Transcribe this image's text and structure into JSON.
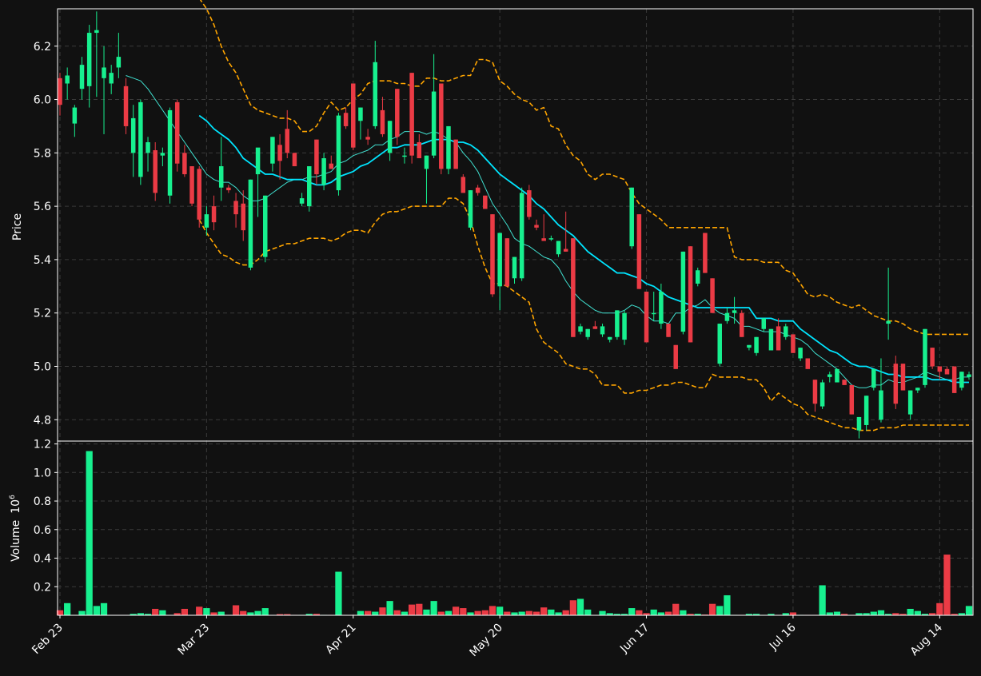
{
  "chart_data": {
    "type": "candlestick",
    "background": "#111111",
    "colors": {
      "up": "#17f08f",
      "down": "#eb3b45",
      "ma_short": "#40e0d0",
      "ma_long": "#00e5ff",
      "bands": "#ffa500",
      "grid": "#3a3a3a",
      "axis": "#ffffff"
    },
    "grid": true,
    "price_panel": {
      "ylabel": "Price",
      "ylim": [
        4.72,
        6.34
      ],
      "yticks": [
        "4.8",
        "5.0",
        "5.2",
        "5.4",
        "5.6",
        "5.8",
        "6.0",
        "6.2"
      ]
    },
    "volume_panel": {
      "ylabel": "Volume",
      "exponent": "10",
      "exponent_power": "6",
      "ylim": [
        0,
        1.22
      ],
      "yticks": [
        "0.2",
        "0.4",
        "0.6",
        "0.8",
        "1.0",
        "1.2"
      ]
    },
    "x_ticks": [
      {
        "label": "Feb 23",
        "i": 0
      },
      {
        "label": "Mar 23",
        "i": 20
      },
      {
        "label": "Apr 21",
        "i": 40
      },
      {
        "label": "May 20",
        "i": 60
      },
      {
        "label": "Jun 17",
        "i": 80
      },
      {
        "label": "Jul 16",
        "i": 100
      },
      {
        "label": "Aug 14",
        "i": 120
      }
    ],
    "n_bars": 125,
    "candles": [
      [
        6.08,
        6.1,
        5.94,
        5.98
      ],
      [
        6.06,
        6.12,
        6.0,
        6.09
      ],
      [
        5.91,
        5.98,
        5.86,
        5.97
      ],
      [
        6.04,
        6.16,
        6.0,
        6.13
      ],
      [
        6.05,
        6.28,
        5.97,
        6.25
      ],
      [
        6.25,
        6.33,
        6.01,
        6.26
      ],
      [
        6.08,
        6.2,
        5.87,
        6.12
      ],
      [
        6.06,
        6.13,
        6.02,
        6.1
      ],
      [
        6.12,
        6.25,
        6.08,
        6.16
      ],
      [
        6.05,
        6.08,
        5.87,
        5.9
      ],
      [
        5.8,
        5.98,
        5.71,
        5.93
      ],
      [
        5.71,
        6.0,
        5.68,
        5.99
      ],
      [
        5.8,
        5.86,
        5.73,
        5.84
      ],
      [
        5.81,
        5.84,
        5.62,
        5.65
      ],
      [
        5.79,
        5.82,
        5.75,
        5.8
      ],
      [
        5.64,
        5.97,
        5.61,
        5.96
      ],
      [
        5.99,
        6.0,
        5.73,
        5.76
      ],
      [
        5.8,
        5.83,
        5.71,
        5.72
      ],
      [
        5.75,
        5.75,
        5.6,
        5.61
      ],
      [
        5.74,
        5.75,
        5.52,
        5.55
      ],
      [
        5.52,
        5.6,
        5.49,
        5.57
      ],
      [
        5.6,
        5.64,
        5.51,
        5.54
      ],
      [
        5.67,
        5.86,
        5.62,
        5.75
      ],
      [
        5.67,
        5.68,
        5.65,
        5.66
      ],
      [
        5.62,
        5.65,
        5.52,
        5.57
      ],
      [
        5.61,
        5.66,
        5.47,
        5.51
      ],
      [
        5.37,
        5.7,
        5.36,
        5.7
      ],
      [
        5.72,
        5.77,
        5.56,
        5.82
      ],
      [
        5.41,
        5.64,
        5.39,
        5.64
      ],
      [
        5.76,
        5.86,
        5.73,
        5.86
      ],
      [
        5.83,
        5.87,
        5.7,
        5.77
      ],
      [
        5.89,
        5.96,
        5.78,
        5.8
      ],
      [
        5.8,
        5.8,
        5.75,
        5.75
      ],
      [
        5.61,
        5.65,
        5.6,
        5.63
      ],
      [
        5.6,
        5.75,
        5.58,
        5.75
      ],
      [
        5.85,
        5.85,
        5.68,
        5.72
      ],
      [
        5.68,
        5.8,
        5.66,
        5.78
      ],
      [
        5.76,
        5.79,
        5.75,
        5.74
      ],
      [
        5.66,
        5.95,
        5.64,
        5.94
      ],
      [
        5.95,
        5.97,
        5.89,
        5.9
      ],
      [
        6.06,
        6.06,
        5.81,
        5.82
      ],
      [
        5.92,
        5.97,
        5.85,
        5.97
      ],
      [
        5.86,
        5.89,
        5.83,
        5.85
      ],
      [
        5.9,
        6.22,
        5.89,
        6.14
      ],
      [
        5.96,
        6.01,
        5.86,
        5.87
      ],
      [
        5.8,
        5.92,
        5.77,
        5.92
      ],
      [
        6.04,
        6.04,
        5.83,
        5.86
      ],
      [
        5.79,
        5.82,
        5.76,
        5.79
      ],
      [
        6.1,
        6.1,
        5.76,
        5.79
      ],
      [
        5.84,
        5.87,
        5.78,
        5.78
      ],
      [
        5.74,
        5.79,
        5.61,
        5.79
      ],
      [
        5.79,
        6.17,
        5.78,
        6.03
      ],
      [
        6.06,
        6.06,
        5.72,
        5.74
      ],
      [
        5.74,
        5.9,
        5.72,
        5.9
      ],
      [
        5.85,
        5.85,
        5.74,
        5.74
      ],
      [
        5.71,
        5.72,
        5.65,
        5.65
      ],
      [
        5.52,
        5.66,
        5.51,
        5.66
      ],
      [
        5.67,
        5.68,
        5.64,
        5.65
      ],
      [
        5.64,
        5.64,
        5.59,
        5.59
      ],
      [
        5.57,
        5.57,
        5.26,
        5.27
      ],
      [
        5.3,
        5.5,
        5.21,
        5.5
      ],
      [
        5.48,
        5.48,
        5.3,
        5.3
      ],
      [
        5.33,
        5.41,
        5.31,
        5.41
      ],
      [
        5.33,
        5.67,
        5.32,
        5.65
      ],
      [
        5.66,
        5.68,
        5.55,
        5.56
      ],
      [
        5.53,
        5.55,
        5.51,
        5.52
      ],
      [
        5.48,
        5.57,
        5.47,
        5.47
      ],
      [
        5.48,
        5.49,
        5.47,
        5.48
      ],
      [
        5.42,
        5.47,
        5.41,
        5.47
      ],
      [
        5.44,
        5.58,
        5.43,
        5.43
      ],
      [
        5.48,
        5.48,
        5.11,
        5.11
      ],
      [
        5.13,
        5.16,
        5.12,
        5.15
      ],
      [
        5.11,
        5.14,
        5.1,
        5.14
      ],
      [
        5.15,
        5.17,
        5.14,
        5.14
      ],
      [
        5.12,
        5.16,
        5.11,
        5.15
      ],
      [
        5.1,
        5.11,
        5.09,
        5.11
      ],
      [
        5.11,
        5.21,
        5.1,
        5.21
      ],
      [
        5.1,
        5.21,
        5.08,
        5.2
      ],
      [
        5.45,
        5.67,
        5.44,
        5.67
      ],
      [
        5.57,
        5.57,
        5.29,
        5.29
      ],
      [
        5.28,
        5.28,
        5.09,
        5.09
      ],
      [
        5.2,
        5.28,
        5.17,
        5.2
      ],
      [
        5.16,
        5.31,
        5.14,
        5.28
      ],
      [
        5.16,
        5.16,
        5.11,
        5.11
      ],
      [
        5.08,
        5.08,
        4.99,
        4.99
      ],
      [
        5.13,
        5.43,
        5.12,
        5.43
      ],
      [
        5.45,
        5.45,
        5.09,
        5.09
      ],
      [
        5.31,
        5.37,
        5.3,
        5.36
      ],
      [
        5.5,
        5.5,
        5.35,
        5.35
      ],
      [
        5.33,
        5.33,
        5.2,
        5.2
      ],
      [
        5.01,
        5.16,
        5.0,
        5.16
      ],
      [
        5.17,
        5.22,
        5.16,
        5.2
      ],
      [
        5.2,
        5.26,
        5.16,
        5.21
      ],
      [
        5.2,
        5.21,
        5.11,
        5.11
      ],
      [
        5.07,
        5.08,
        5.06,
        5.08
      ],
      [
        5.05,
        5.11,
        5.04,
        5.11
      ],
      [
        5.14,
        5.18,
        5.13,
        5.18
      ],
      [
        5.06,
        5.14,
        5.06,
        5.14
      ],
      [
        5.15,
        5.18,
        5.06,
        5.06
      ],
      [
        5.11,
        5.16,
        5.1,
        5.15
      ],
      [
        5.12,
        5.12,
        5.05,
        5.05
      ],
      [
        5.03,
        5.07,
        5.02,
        5.07
      ],
      [
        5.03,
        5.03,
        4.99,
        4.99
      ],
      [
        4.95,
        4.95,
        4.83,
        4.86
      ],
      [
        4.85,
        4.95,
        4.84,
        4.94
      ],
      [
        4.96,
        4.98,
        4.94,
        4.97
      ],
      [
        4.94,
        4.99,
        4.94,
        4.99
      ],
      [
        4.95,
        4.95,
        4.93,
        4.93
      ],
      [
        4.93,
        4.93,
        4.82,
        4.82
      ],
      [
        4.76,
        4.81,
        4.73,
        4.81
      ],
      [
        4.78,
        4.89,
        4.76,
        4.89
      ],
      [
        4.92,
        4.99,
        4.91,
        4.99
      ],
      [
        4.8,
        5.03,
        4.79,
        4.91
      ],
      [
        5.16,
        5.37,
        5.1,
        5.17
      ],
      [
        5.01,
        5.04,
        4.84,
        4.86
      ],
      [
        5.01,
        5.01,
        4.91,
        4.91
      ],
      [
        4.82,
        4.91,
        4.8,
        4.91
      ],
      [
        4.91,
        4.92,
        4.9,
        4.92
      ],
      [
        4.93,
        5.14,
        4.92,
        5.14
      ],
      [
        5.07,
        5.07,
        4.99,
        5.0
      ],
      [
        5.0,
        5.0,
        4.95,
        4.98
      ],
      [
        4.99,
        5.0,
        4.97,
        4.97
      ],
      [
        5.0,
        5.0,
        4.9,
        4.9
      ],
      [
        4.92,
        4.98,
        4.91,
        4.98
      ],
      [
        4.96,
        4.98,
        4.95,
        4.97
      ]
    ],
    "volumes": [
      0.035,
      0.085,
      0.003,
      0.03,
      1.15,
      0.065,
      0.085,
      0.002,
      0.002,
      0.002,
      0.01,
      0.015,
      0.01,
      0.045,
      0.035,
      0.002,
      0.015,
      0.045,
      0.003,
      0.06,
      0.05,
      0.02,
      0.025,
      0.003,
      0.07,
      0.03,
      0.02,
      0.03,
      0.05,
      0.002,
      0.008,
      0.008,
      0.003,
      0.003,
      0.01,
      0.01,
      0.003,
      0.003,
      0.305,
      0.002,
      0.003,
      0.03,
      0.03,
      0.025,
      0.055,
      0.1,
      0.035,
      0.025,
      0.075,
      0.08,
      0.04,
      0.1,
      0.025,
      0.03,
      0.06,
      0.05,
      0.02,
      0.03,
      0.035,
      0.065,
      0.06,
      0.025,
      0.02,
      0.025,
      0.03,
      0.025,
      0.055,
      0.04,
      0.02,
      0.035,
      0.105,
      0.115,
      0.04,
      0.002,
      0.03,
      0.015,
      0.01,
      0.01,
      0.05,
      0.035,
      0.015,
      0.04,
      0.02,
      0.025,
      0.08,
      0.035,
      0.01,
      0.01,
      0.005,
      0.08,
      0.065,
      0.14,
      0.003,
      0.003,
      0.01,
      0.01,
      0.003,
      0.01,
      0.003,
      0.015,
      0.02,
      0.003,
      0.003,
      0.003,
      0.21,
      0.02,
      0.025,
      0.01,
      0.003,
      0.015,
      0.015,
      0.025,
      0.035,
      0.01,
      0.015,
      0.01,
      0.045,
      0.03,
      0.01,
      0.015,
      0.085,
      0.425,
      0.01,
      0.015,
      0.065,
      0.01
    ],
    "ma_short": [
      null,
      null,
      null,
      null,
      null,
      null,
      null,
      null,
      null,
      6.09,
      6.08,
      6.07,
      6.04,
      6.0,
      5.96,
      5.92,
      5.88,
      5.84,
      5.8,
      5.76,
      5.72,
      5.7,
      5.69,
      5.69,
      5.67,
      5.64,
      5.62,
      5.62,
      5.63,
      5.65,
      5.67,
      5.69,
      5.7,
      5.7,
      5.71,
      5.71,
      5.72,
      5.73,
      5.76,
      5.77,
      5.79,
      5.8,
      5.81,
      5.83,
      5.83,
      5.85,
      5.86,
      5.88,
      5.88,
      5.88,
      5.87,
      5.88,
      5.87,
      5.85,
      5.84,
      5.8,
      5.77,
      5.73,
      5.67,
      5.61,
      5.57,
      5.53,
      5.48,
      5.46,
      5.45,
      5.43,
      5.41,
      5.4,
      5.37,
      5.32,
      5.28,
      5.25,
      5.23,
      5.21,
      5.2,
      5.2,
      5.2,
      5.21,
      5.23,
      5.22,
      5.19,
      5.17,
      5.17,
      5.16,
      5.2,
      5.2,
      5.22,
      5.23,
      5.25,
      5.22,
      5.2,
      5.19,
      5.18,
      5.15,
      5.15,
      5.14,
      5.13,
      5.13,
      5.13,
      5.12,
      5.11,
      5.1,
      5.08,
      5.05,
      5.03,
      5.01,
      4.99,
      4.96,
      4.93,
      4.92,
      4.92,
      4.93,
      4.93,
      4.95,
      4.94,
      4.94,
      4.95,
      4.96,
      4.98,
      4.97,
      4.96,
      4.95,
      4.95,
      4.96,
      4.96
    ],
    "ma_long": [
      null,
      null,
      null,
      null,
      null,
      null,
      null,
      null,
      null,
      null,
      null,
      null,
      null,
      null,
      null,
      null,
      null,
      null,
      null,
      5.94,
      5.92,
      5.89,
      5.87,
      5.85,
      5.82,
      5.78,
      5.76,
      5.74,
      5.72,
      5.72,
      5.71,
      5.7,
      5.7,
      5.7,
      5.69,
      5.68,
      5.68,
      5.69,
      5.71,
      5.72,
      5.73,
      5.75,
      5.76,
      5.78,
      5.8,
      5.82,
      5.82,
      5.83,
      5.83,
      5.83,
      5.84,
      5.85,
      5.85,
      5.85,
      5.84,
      5.84,
      5.83,
      5.81,
      5.78,
      5.75,
      5.72,
      5.7,
      5.68,
      5.66,
      5.64,
      5.61,
      5.59,
      5.56,
      5.53,
      5.51,
      5.49,
      5.46,
      5.43,
      5.41,
      5.39,
      5.37,
      5.35,
      5.35,
      5.34,
      5.33,
      5.31,
      5.3,
      5.28,
      5.26,
      5.25,
      5.24,
      5.23,
      5.22,
      5.22,
      5.22,
      5.22,
      5.22,
      5.22,
      5.22,
      5.22,
      5.18,
      5.18,
      5.18,
      5.17,
      5.17,
      5.17,
      5.14,
      5.12,
      5.1,
      5.08,
      5.06,
      5.05,
      5.03,
      5.01,
      5.0,
      5.0,
      4.99,
      4.98,
      4.97,
      4.97,
      4.96,
      4.96,
      4.96,
      4.96,
      4.95,
      4.95,
      4.95,
      4.94,
      4.94,
      4.94
    ],
    "upper_band": [
      null,
      null,
      null,
      null,
      null,
      null,
      null,
      null,
      null,
      null,
      null,
      null,
      null,
      null,
      null,
      null,
      null,
      null,
      null,
      6.38,
      6.34,
      6.28,
      6.2,
      6.14,
      6.1,
      6.04,
      5.98,
      5.96,
      5.95,
      5.94,
      5.93,
      5.93,
      5.92,
      5.88,
      5.88,
      5.9,
      5.95,
      5.99,
      5.96,
      5.97,
      6.0,
      6.02,
      6.06,
      6.07,
      6.07,
      6.07,
      6.06,
      6.06,
      6.05,
      6.05,
      6.08,
      6.08,
      6.07,
      6.07,
      6.08,
      6.09,
      6.09,
      6.15,
      6.15,
      6.14,
      6.07,
      6.05,
      6.02,
      6.0,
      5.99,
      5.96,
      5.97,
      5.9,
      5.89,
      5.83,
      5.79,
      5.77,
      5.72,
      5.7,
      5.72,
      5.72,
      5.71,
      5.7,
      5.65,
      5.61,
      5.59,
      5.57,
      5.55,
      5.52,
      5.52,
      5.52,
      5.52,
      5.52,
      5.52,
      5.52,
      5.52,
      5.52,
      5.41,
      5.4,
      5.4,
      5.4,
      5.39,
      5.39,
      5.39,
      5.36,
      5.35,
      5.31,
      5.27,
      5.26,
      5.27,
      5.26,
      5.24,
      5.23,
      5.22,
      5.23,
      5.21,
      5.19,
      5.18,
      5.17,
      5.17,
      5.16,
      5.14,
      5.13,
      5.12,
      5.12,
      5.12,
      5.12,
      5.12,
      5.12,
      5.12
    ],
    "lower_band": [
      null,
      null,
      null,
      null,
      null,
      null,
      null,
      null,
      null,
      null,
      null,
      null,
      null,
      null,
      null,
      null,
      null,
      null,
      null,
      5.55,
      5.5,
      5.46,
      5.42,
      5.41,
      5.39,
      5.38,
      5.38,
      5.4,
      5.43,
      5.44,
      5.45,
      5.46,
      5.46,
      5.47,
      5.48,
      5.48,
      5.48,
      5.47,
      5.48,
      5.5,
      5.51,
      5.51,
      5.5,
      5.54,
      5.57,
      5.58,
      5.58,
      5.59,
      5.6,
      5.6,
      5.6,
      5.6,
      5.6,
      5.63,
      5.63,
      5.61,
      5.55,
      5.45,
      5.37,
      5.31,
      5.31,
      5.3,
      5.28,
      5.26,
      5.24,
      5.14,
      5.09,
      5.07,
      5.05,
      5.01,
      5.0,
      4.99,
      4.99,
      4.97,
      4.93,
      4.93,
      4.93,
      4.9,
      4.9,
      4.91,
      4.91,
      4.92,
      4.93,
      4.93,
      4.94,
      4.94,
      4.93,
      4.92,
      4.92,
      4.97,
      4.96,
      4.96,
      4.96,
      4.96,
      4.95,
      4.95,
      4.92,
      4.87,
      4.9,
      4.88,
      4.86,
      4.85,
      4.82,
      4.81,
      4.8,
      4.79,
      4.78,
      4.77,
      4.77,
      4.76,
      4.76,
      4.76,
      4.77,
      4.77,
      4.77,
      4.78,
      4.78,
      4.78,
      4.78,
      4.78,
      4.78,
      4.78,
      4.78,
      4.78,
      4.78
    ]
  }
}
